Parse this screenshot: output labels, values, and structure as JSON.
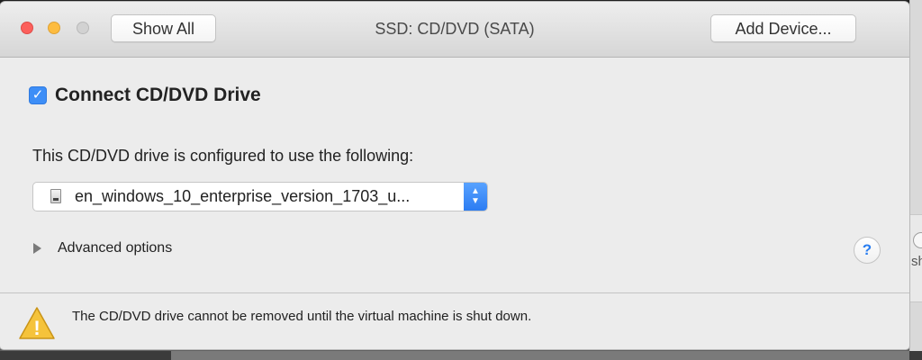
{
  "window": {
    "title": "SSD: CD/DVD (SATA)",
    "toolbar": {
      "show_all_label": "Show All",
      "add_device_label": "Add Device..."
    }
  },
  "connect": {
    "label": "Connect CD/DVD Drive",
    "checked": true,
    "check_glyph": "✓"
  },
  "config": {
    "description": "This CD/DVD drive is configured to use the following:",
    "selected_file": "en_windows_10_enterprise_version_1703_u...",
    "stepper_glyph_up": "▲",
    "stepper_glyph_down": "▼"
  },
  "advanced": {
    "label": "Advanced options"
  },
  "help": {
    "glyph": "?"
  },
  "warning": {
    "text": "The CD/DVD drive cannot be removed until the virtual machine is shut down.",
    "glyph": "!"
  },
  "background": {
    "partial_text": "sh"
  },
  "colors": {
    "accent": "#3d8ef7",
    "close": "#fc605c",
    "minimize": "#fdbc40",
    "zoom": "#d2d2d2",
    "warning": "#f5c33b"
  },
  "icons": [
    "close-icon",
    "minimize-icon",
    "zoom-icon",
    "checkbox-check-icon",
    "disk-image-icon",
    "stepper-icon",
    "disclosure-triangle-icon",
    "help-icon",
    "warning-icon"
  ]
}
